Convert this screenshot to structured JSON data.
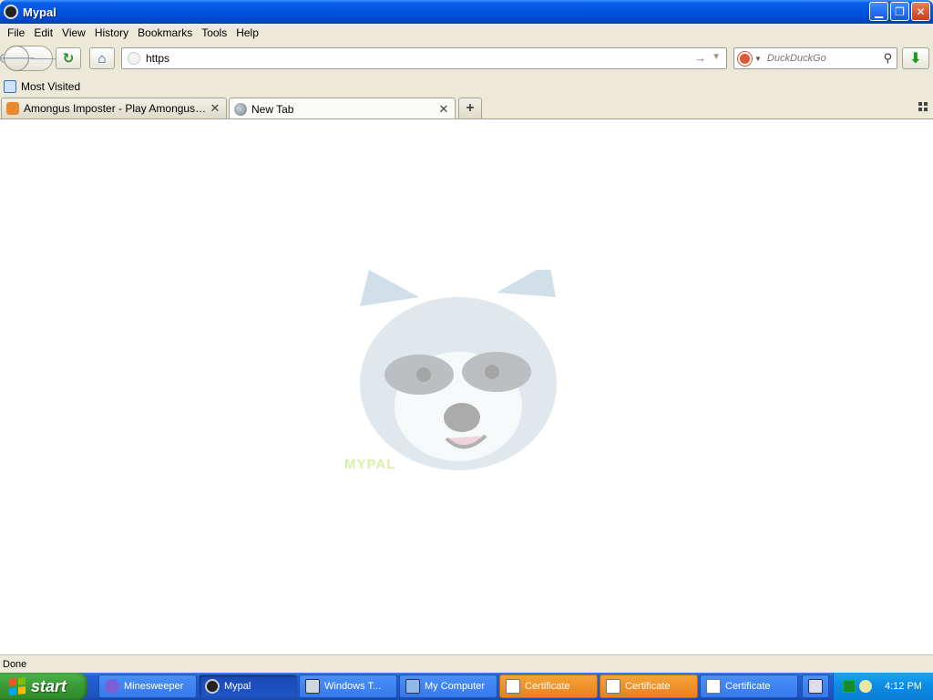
{
  "window": {
    "title": "Mypal"
  },
  "menu": [
    "File",
    "Edit",
    "View",
    "History",
    "Bookmarks",
    "Tools",
    "Help"
  ],
  "nav": {
    "url_value": "https",
    "search_placeholder": "DuckDuckGo"
  },
  "bookmarks": {
    "most_visited": "Most Visited"
  },
  "tabs": [
    {
      "label": "Amongus Imposter - Play Amongus Impo...",
      "active": false
    },
    {
      "label": "New Tab",
      "active": true
    }
  ],
  "content": {
    "logo_text": "MYPAL"
  },
  "status": {
    "text": "Done"
  },
  "taskbar": {
    "start_label": "start",
    "tasks": [
      {
        "label": "Minesweeper"
      },
      {
        "label": "Mypal"
      },
      {
        "label": "Windows T..."
      },
      {
        "label": "My Computer"
      },
      {
        "label": "Certificate"
      },
      {
        "label": "Certificate"
      },
      {
        "label": "Certificate"
      }
    ],
    "clock": "4:12 PM"
  },
  "colors": {
    "titlebar": "#0054e3",
    "taskbar": "#245edb",
    "start": "#3a9a36",
    "tray": "#0c8ae3",
    "task_orange": "#e8811b"
  },
  "icons": {
    "app": "raccoon-icon",
    "back": "back-arrow-icon",
    "forward": "forward-arrow-icon",
    "reload": "reload-icon",
    "home": "home-icon",
    "go": "go-arrow-icon",
    "search": "magnifier-icon",
    "download": "download-arrow-icon"
  }
}
